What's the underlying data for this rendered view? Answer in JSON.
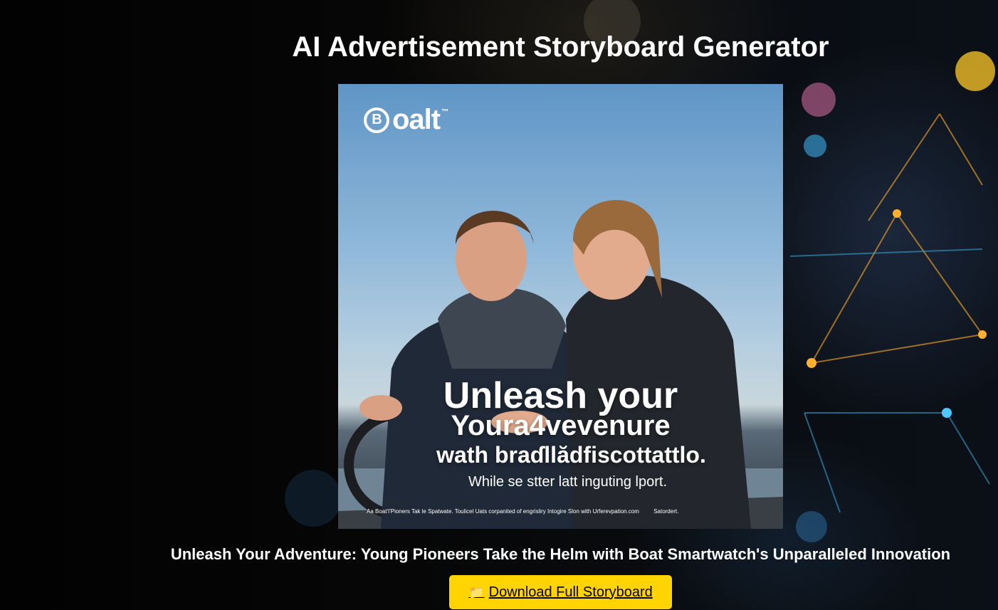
{
  "page": {
    "title": "AI Advertisement Storyboard Generator",
    "caption": "Unleash Your Adventure: Young Pioneers Take the Helm with Boat Smartwatch's Unparalleled Innovation"
  },
  "poster": {
    "brand": "oalt",
    "brand_icon_letter": "B",
    "brand_trademark": "™",
    "headline_line1": "Unleash your",
    "headline_line2": "Youra4vevenure",
    "headline_line3": "wath braɗllădfiscottattlo.",
    "subline": "While se stter latt inguting lport.",
    "fineprint_left": "Aa Boat'I'Pioners Tak le Spatwate. Toulicel Uats corpanited of engrisliry Intogire Slon with Urferevpation.com",
    "fineprint_right": "Satordert."
  },
  "actions": {
    "download_icon": "📁",
    "download_label": "Download Full Storyboard"
  },
  "colors": {
    "background": "#000000",
    "button": "#ffd400",
    "text": "#ffffff"
  }
}
